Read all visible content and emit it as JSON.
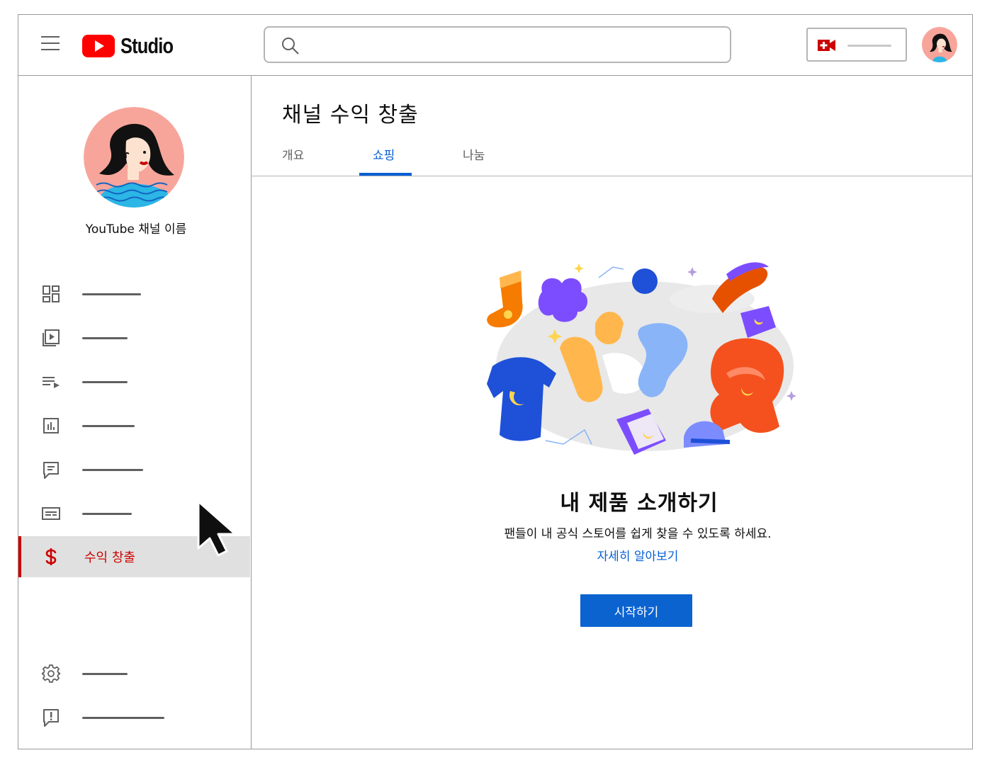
{
  "header": {
    "logo_text": "Studio",
    "search": {
      "placeholder": ""
    },
    "create_button_icon": "video-camera-plus-icon",
    "brand_color": "#ff0000"
  },
  "sidebar": {
    "channel_name": "YouTube 채널 이름",
    "items": [
      {
        "icon": "dashboard-icon",
        "label": ""
      },
      {
        "icon": "content-icon",
        "label": ""
      },
      {
        "icon": "playlists-icon",
        "label": ""
      },
      {
        "icon": "analytics-icon",
        "label": ""
      },
      {
        "icon": "comments-icon",
        "label": ""
      },
      {
        "icon": "subtitles-icon",
        "label": ""
      },
      {
        "icon": "monetization-icon",
        "label": "수익 창출",
        "active": true
      },
      {
        "icon": "settings-icon",
        "label": ""
      },
      {
        "icon": "feedback-icon",
        "label": ""
      }
    ],
    "active_color": "#cc0000"
  },
  "main": {
    "title": "채널 수익 창출",
    "tabs": [
      {
        "label": "개요"
      },
      {
        "label": "쇼핑",
        "active": true
      },
      {
        "label": "나눔"
      }
    ],
    "promo": {
      "title": "내 제품 소개하기",
      "description": "팬들이 내 공식 스토어를 쉽게 찾을 수 있도록 하세요.",
      "learn_more": "자세히 알아보기",
      "cta_label": "시작하기"
    },
    "accent_color": "#065fd4"
  }
}
